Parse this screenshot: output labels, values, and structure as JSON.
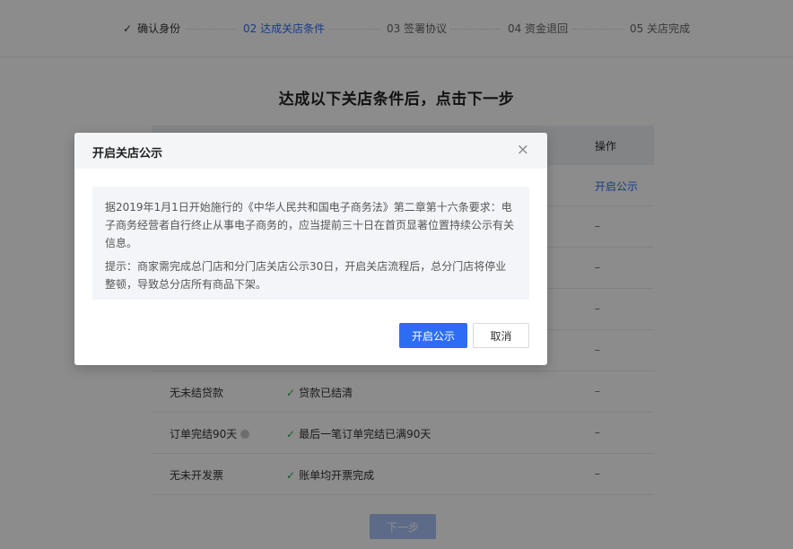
{
  "stepper": {
    "steps": [
      {
        "check": "✓",
        "label": "确认身份"
      },
      {
        "label": "02 达成关店条件"
      },
      {
        "label": "03 签署协议"
      },
      {
        "label": "04 资金退回"
      },
      {
        "label": "05 关店完成"
      }
    ]
  },
  "main": {
    "title": "达成以下关店条件后，点击下一步",
    "table": {
      "op_header": "操作",
      "rows": [
        {
          "name": "",
          "status": "",
          "op": "开启公示"
        },
        {
          "name": "",
          "status": "",
          "op": "–"
        },
        {
          "name": "",
          "status": "",
          "op": "–"
        },
        {
          "name": "",
          "status": "",
          "op": "–"
        },
        {
          "name": "",
          "status": "",
          "op": "–"
        },
        {
          "name": "无未结贷款",
          "check": "✓",
          "status": "贷款已结清",
          "op": "–"
        },
        {
          "name": "订单完结90天",
          "check": "✓",
          "status": "最后一笔订单完结已满90天",
          "op": "–"
        },
        {
          "name": "无未开发票",
          "check": "✓",
          "status": "账单均开票完成",
          "op": "–"
        }
      ]
    },
    "next_label": "下一步"
  },
  "modal": {
    "title": "开启关店公示",
    "close": "×",
    "paragraph1": "据2019年1月1日开始施行的《中华人民共和国电子商务法》第二章第十六条要求：电子商务经营者自行终止从事电子商务的，应当提前三十日在首页显著位置持续公示有关信息。",
    "paragraph2": "提示：商家需完成总门店和分门店关店公示30日，开启关店流程后，总分门店将停业整顿，导致总分店所有商品下架。",
    "confirm_label": "开启公示",
    "cancel_label": "取消"
  },
  "colors": {
    "accent": "#2d6df6",
    "success": "#2bb24c"
  }
}
